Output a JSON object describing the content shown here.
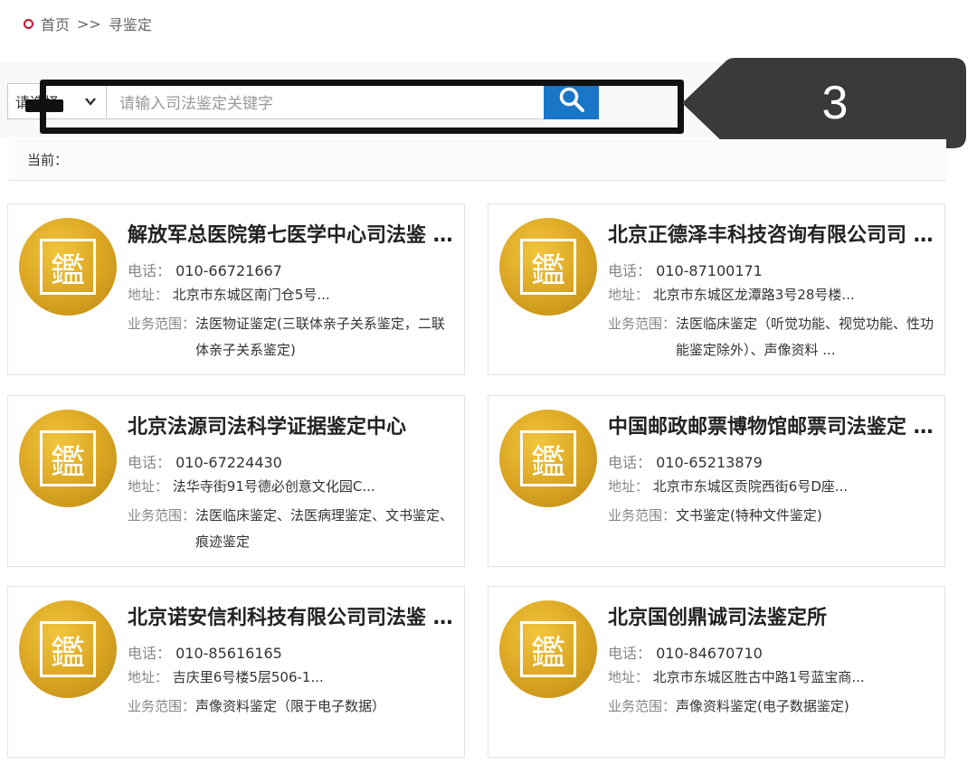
{
  "breadcrumb": {
    "home": "首页",
    "separator": ">>",
    "current": "寻鉴定"
  },
  "search": {
    "select_value": "请选择",
    "placeholder": "请输入司法鉴定关键字"
  },
  "callout": {
    "label": "3"
  },
  "current_label": "当前：",
  "labels": {
    "phone": "电话：",
    "address": "地址：",
    "scope": "业务范围："
  },
  "logo_glyph": "鑑",
  "cards": [
    {
      "title": "解放军总医院第七医学中心司法鉴 ...",
      "phone": "010-66721667",
      "address": "北京市东城区南门仓5号...",
      "scope": "法医物证鉴定(三联体亲子关系鉴定，二联体亲子关系鉴定)"
    },
    {
      "title": "北京正德泽丰科技咨询有限公司司 ...",
      "phone": "010-87100171",
      "address": "北京市东城区龙潭路3号28号楼...",
      "scope": "法医临床鉴定（听觉功能、视觉功能、性功能鉴定除外）、声像资料 ..."
    },
    {
      "title": "北京法源司法科学证据鉴定中心",
      "phone": "010-67224430",
      "address": "法华寺街91号德必创意文化园C...",
      "scope": "法医临床鉴定、法医病理鉴定、文书鉴定、痕迹鉴定"
    },
    {
      "title": "中国邮政邮票博物馆邮票司法鉴定 ...",
      "phone": "010-65213879",
      "address": "北京市东城区贡院西街6号D座...",
      "scope": "文书鉴定(特种文件鉴定)"
    },
    {
      "title": "北京诺安信利科技有限公司司法鉴 ...",
      "phone": "010-85616165",
      "address": "吉庆里6号楼5层506-1...",
      "scope": "声像资料鉴定（限于电子数据）"
    },
    {
      "title": "北京国创鼎诚司法鉴定所",
      "phone": "010-84670710",
      "address": "北京市东城区胜古中路1号蓝宝商...",
      "scope": "声像资料鉴定(电子数据鉴定)"
    }
  ]
}
